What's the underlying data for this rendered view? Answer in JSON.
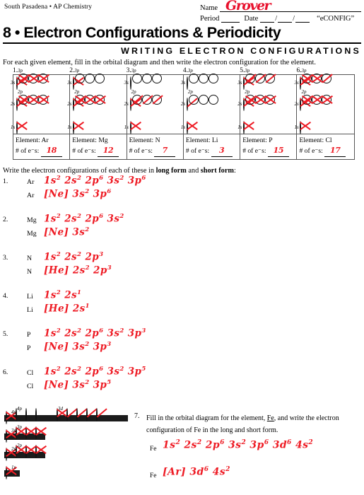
{
  "header": {
    "school": "South Pasadena • AP Chemistry",
    "name_label": "Name",
    "name_value": "Grover",
    "period_label": "Period",
    "date_label": "Date",
    "econfig_tag": "“eCONFIG”"
  },
  "title": "8 • Electron Configurations & Periodicity",
  "subtitle": "WRITING ELECTRON CONFIGURATIONS",
  "intro": "For each given element, fill in the orbital diagram and then write the electron configuration for the element.",
  "orbital_labels": {
    "s3": "3s",
    "p3": "3p",
    "s2": "2s",
    "p2": "2p",
    "s1": "1s",
    "element_label": "Element:",
    "count_label": "# of e⁻s:"
  },
  "orbital_cells": [
    {
      "number": "1.",
      "element": "Ar",
      "count": "18",
      "s3": "x",
      "p3": [
        "x",
        "x",
        "x"
      ],
      "s2": "x",
      "p2": [
        "x",
        "x",
        "x"
      ],
      "s1": "x"
    },
    {
      "number": "2.",
      "element": "Mg",
      "count": "12",
      "s3": "x",
      "p3": [
        "empty",
        "empty",
        "empty"
      ],
      "s2": "x",
      "p2": [
        "x",
        "x",
        "x"
      ],
      "s1": "x"
    },
    {
      "number": "3.",
      "element": "N",
      "count": "7",
      "s3": "empty",
      "p3": [
        "empty",
        "empty",
        "empty"
      ],
      "s2": "x",
      "p2": [
        "half",
        "half",
        "half"
      ],
      "s1": "x"
    },
    {
      "number": "4.",
      "element": "Li",
      "count": "3",
      "s3": "empty",
      "p3": [
        "empty",
        "empty",
        "empty"
      ],
      "s2": "half",
      "p2": [
        "empty",
        "empty",
        "empty"
      ],
      "s1": "x"
    },
    {
      "number": "5.",
      "element": "P",
      "count": "15",
      "s3": "x",
      "p3": [
        "half",
        "half",
        "half"
      ],
      "s2": "x",
      "p2": [
        "x",
        "x",
        "x"
      ],
      "s1": "x"
    },
    {
      "number": "6.",
      "element": "Cl",
      "count": "17",
      "s3": "x",
      "p3": [
        "x",
        "x",
        "half"
      ],
      "s2": "x",
      "p2": [
        "x",
        "x",
        "x"
      ],
      "s1": "x"
    }
  ],
  "written": {
    "intro_a": "Write the electron configurations of each of these in ",
    "intro_b": "long form",
    "intro_c": " and ",
    "intro_d": "short form",
    "intro_e": ":",
    "items": [
      {
        "number": "1.",
        "symbol": "Ar",
        "long": "1s² 2s² 2p⁶ 3s² 3p⁶",
        "short": "[Ne] 3s² 3p⁶"
      },
      {
        "number": "2.",
        "symbol": "Mg",
        "long": "1s² 2s² 2p⁶ 3s²",
        "short": "[Ne] 3s²"
      },
      {
        "number": "3.",
        "symbol": "N",
        "long": "1s² 2s² 2p³",
        "short": "[He] 2s² 2p³"
      },
      {
        "number": "4.",
        "symbol": "Li",
        "long": "1s² 2s¹",
        "short": "[He] 2s¹"
      },
      {
        "number": "5.",
        "symbol": "P",
        "long": "1s² 2s² 2p⁶ 3s² 3p³",
        "short": "[Ne] 3s² 3p³"
      },
      {
        "number": "6.",
        "symbol": "Cl",
        "long": "1s² 2s² 2p⁶ 3s² 3p⁵",
        "short": "[Ne] 3s² 3p⁵"
      }
    ]
  },
  "fe": {
    "question_number": "7.",
    "question_line1_a": "Fill in the orbital diagram for the element, ",
    "question_line1_b": "Fe",
    "question_line1_c": ", and write the electron",
    "question_line2": "configuration of Fe in the long and short form.",
    "symbol": "Fe",
    "long": "1s² 2s² 2p⁶ 3s² 3p⁶ 3d⁶ 4s²",
    "short": "[Ar] 3d⁶ 4s²",
    "labels": {
      "s4": "4s",
      "p4": "4p",
      "d3": "3d",
      "s3": "3s",
      "p3": "3p",
      "s2": "2s",
      "p2": "2p",
      "s1": "1s"
    },
    "rows": [
      {
        "s": "x",
        "p": [
          "empty",
          "empty",
          "empty"
        ],
        "d": [
          "x",
          "half",
          "half",
          "half",
          "half"
        ]
      },
      {
        "s": "x",
        "p": [
          "x",
          "x",
          "x"
        ]
      },
      {
        "s": "x",
        "p": [
          "x",
          "x",
          "x"
        ]
      },
      {
        "s": "x"
      }
    ]
  },
  "colors": {
    "ink_red": "#ee1b24",
    "rule": "#555555",
    "bar": "#1b1b1b"
  }
}
